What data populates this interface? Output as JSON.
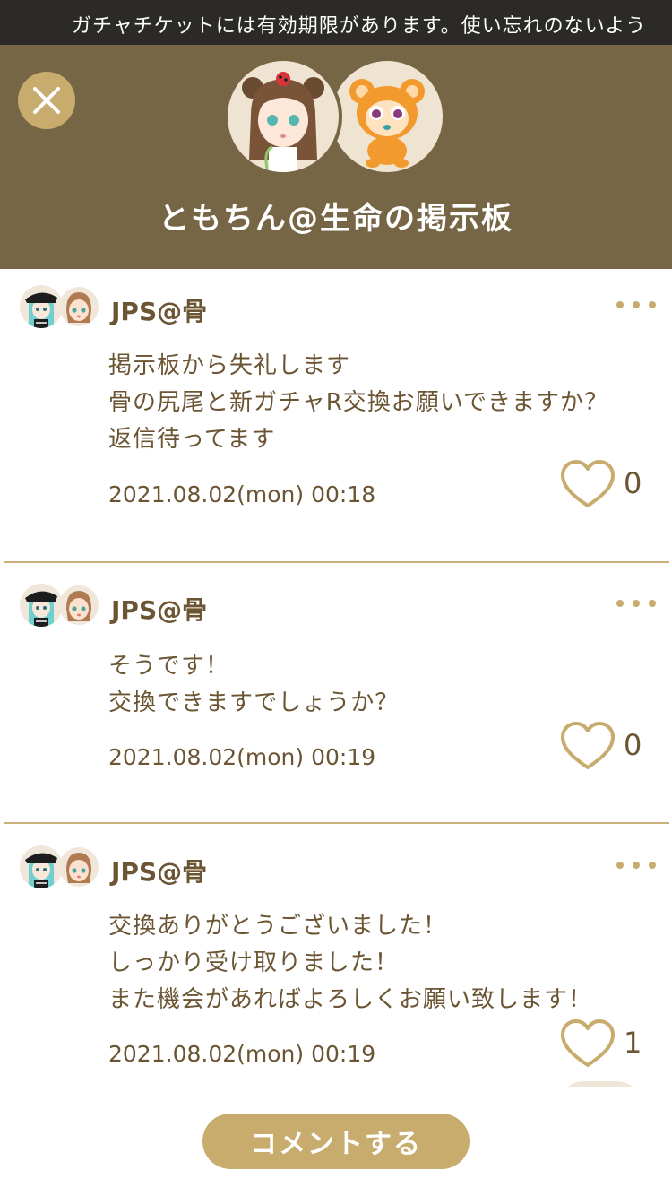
{
  "ticker": {
    "text": "ガチャチケットには有効期限があります。使い忘れのないよう"
  },
  "header": {
    "title": "ともちん@生命の掲示板"
  },
  "colors": {
    "header_bg": "#776645",
    "accent": "#c8ac6e",
    "text": "#6b5533",
    "ticker_bg": "#2b2a26"
  },
  "posts": [
    {
      "user": "JPS@骨",
      "lines": [
        "掲示板から失礼します",
        "骨の尻尾と新ガチャR交換お願いできますか？",
        "返信待ってます"
      ],
      "date": "2021.08.02(mon) 00:18",
      "likes": "0"
    },
    {
      "user": "JPS@骨",
      "lines": [
        "そうです！",
        "交換できますでしょうか？"
      ],
      "date": "2021.08.02(mon) 00:19",
      "likes": "0"
    },
    {
      "user": "JPS@骨",
      "lines": [
        "交換ありがとうございました！",
        "しっかり受け取りました！",
        "また機会があればよろしくお願い致します！"
      ],
      "date": "2021.08.02(mon) 00:19",
      "likes": "1"
    }
  ],
  "footer": {
    "comment_label": "コメントする"
  },
  "icons": {
    "close": "close-icon",
    "like": "heart-icon",
    "more": "more-dots-icon"
  }
}
